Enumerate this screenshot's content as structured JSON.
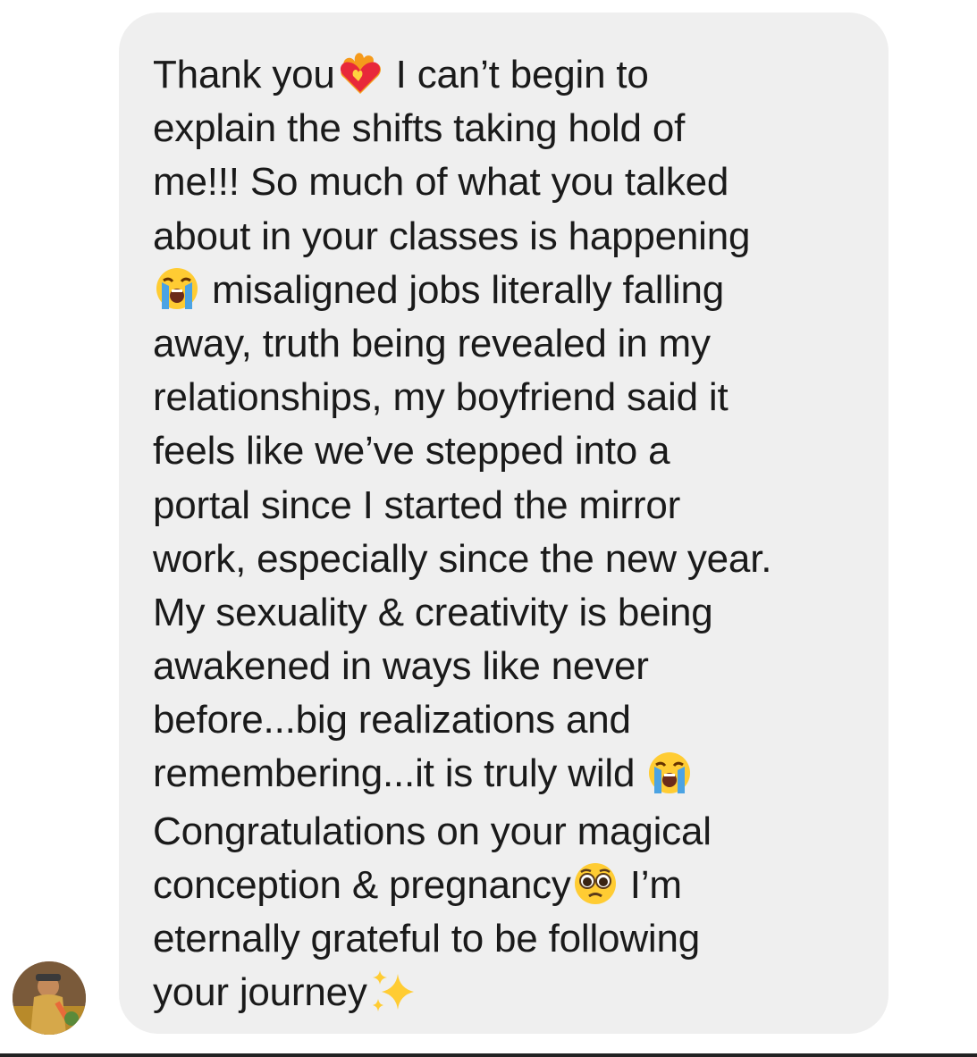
{
  "message": {
    "lines": [
      {
        "pre": "Thank you",
        "emoji": "heart-on-fire-icon",
        "post": " I can’t begin to"
      },
      {
        "text": "explain the shifts taking hold of"
      },
      {
        "text": "me!!! So much of what you talked"
      },
      {
        "text": "about in your classes is happening"
      },
      {
        "pre": "",
        "emoji": "loudly-crying-face-icon",
        "post": " misaligned jobs literally falling"
      },
      {
        "text": "away, truth being revealed in my"
      },
      {
        "text": "relationships, my boyfriend said it"
      },
      {
        "text": "feels like we’ve stepped into a"
      },
      {
        "text": "portal since I started the mirror"
      },
      {
        "text": "work, especially since the new year."
      },
      {
        "text": "My sexuality & creativity is being"
      },
      {
        "text": "awakened in ways like never"
      },
      {
        "text": "before...big realizations and"
      },
      {
        "pre": "remembering...it is truly wild ",
        "emoji": "loudly-crying-face-icon",
        "post": ""
      },
      {
        "text": "Congratulations on your magical"
      },
      {
        "pre": "conception & pregnancy",
        "emoji": "pleading-face-icon",
        "post": " I’m"
      },
      {
        "text": "eternally grateful to be following"
      },
      {
        "pre": "your journey",
        "emoji": "sparkles-icon",
        "post": ""
      }
    ]
  },
  "colors": {
    "bubble": "#efefef",
    "text": "#1a1a1a"
  }
}
